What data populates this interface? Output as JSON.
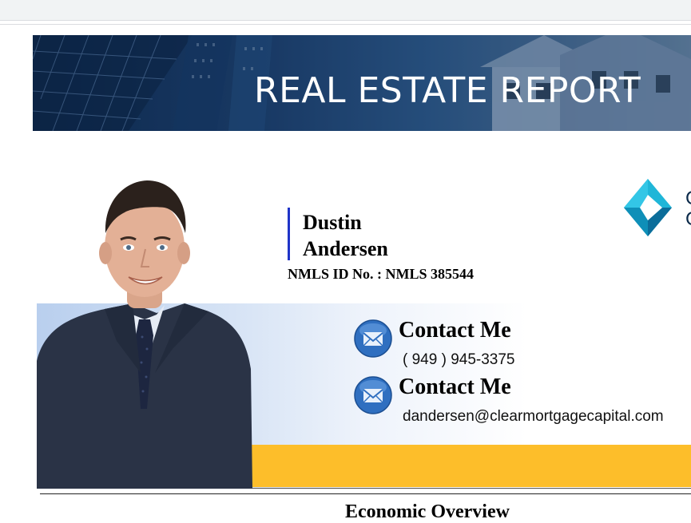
{
  "banner": {
    "title": "REAL ESTATE REPORT"
  },
  "agent": {
    "first_name": "Dustin",
    "last_name": "Andersen",
    "nmls": "NMLS ID No. : NMLS 385544"
  },
  "contacts": [
    {
      "title": "Contact Me",
      "value": "( 949 ) 945-3375",
      "icon": "envelope-icon"
    },
    {
      "title": "Contact Me",
      "value": "dandersen@clearmortgagecapital.com",
      "icon": "envelope-icon"
    }
  ],
  "logo": {
    "icon": "company-logo-icon",
    "text": "C\nC",
    "colors": [
      "#1fb6d8",
      "#0e8fb8",
      "#0b6d9a"
    ]
  },
  "next_section": {
    "heading": "Economic Overview"
  },
  "colors": {
    "banner_dark": "#0f2a4f",
    "accent_bar": "#1f34c8",
    "gold": "#fdbe2a",
    "icon_blue": "#2f6fc0"
  }
}
